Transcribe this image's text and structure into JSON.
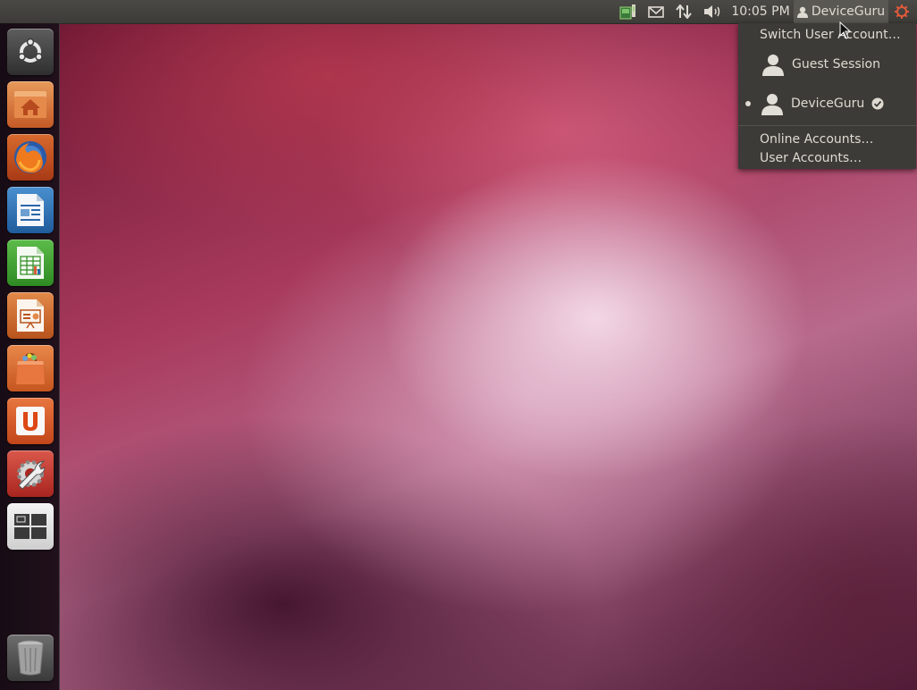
{
  "top_panel": {
    "indicators": {
      "network_icon": "network-icon",
      "mail_icon": "envelope-icon",
      "transfer_icon": "arrows-updown-icon",
      "sound_icon": "speaker-icon",
      "session_icon": "gear-power-icon"
    },
    "clock": "10:05 PM",
    "user_name": "DeviceGuru"
  },
  "launcher": {
    "items": [
      {
        "name": "Dash home",
        "icon": "ubuntu-logo-icon"
      },
      {
        "name": "Home Folder",
        "icon": "home-folder-icon"
      },
      {
        "name": "Firefox Web Browser",
        "icon": "firefox-icon"
      },
      {
        "name": "LibreOffice Writer",
        "icon": "writer-icon"
      },
      {
        "name": "LibreOffice Calc",
        "icon": "calc-icon"
      },
      {
        "name": "LibreOffice Impress",
        "icon": "impress-icon"
      },
      {
        "name": "Ubuntu Software Center",
        "icon": "shopping-bag-icon"
      },
      {
        "name": "Ubuntu One",
        "icon": "ubuntu-one-icon"
      },
      {
        "name": "System Settings",
        "icon": "settings-wrench-icon"
      },
      {
        "name": "Workspace Switcher",
        "icon": "workspaces-icon"
      },
      {
        "name": "Trash",
        "icon": "trash-icon"
      }
    ]
  },
  "user_menu": {
    "switch_user": "Switch User Account…",
    "guest": "Guest Session",
    "current_user": "DeviceGuru",
    "online_accounts": "Online Accounts…",
    "user_accounts": "User Accounts…"
  },
  "colors": {
    "panel_bg": "#3c3b37",
    "text": "#dfdbd2",
    "accent": "#e05a3a"
  }
}
